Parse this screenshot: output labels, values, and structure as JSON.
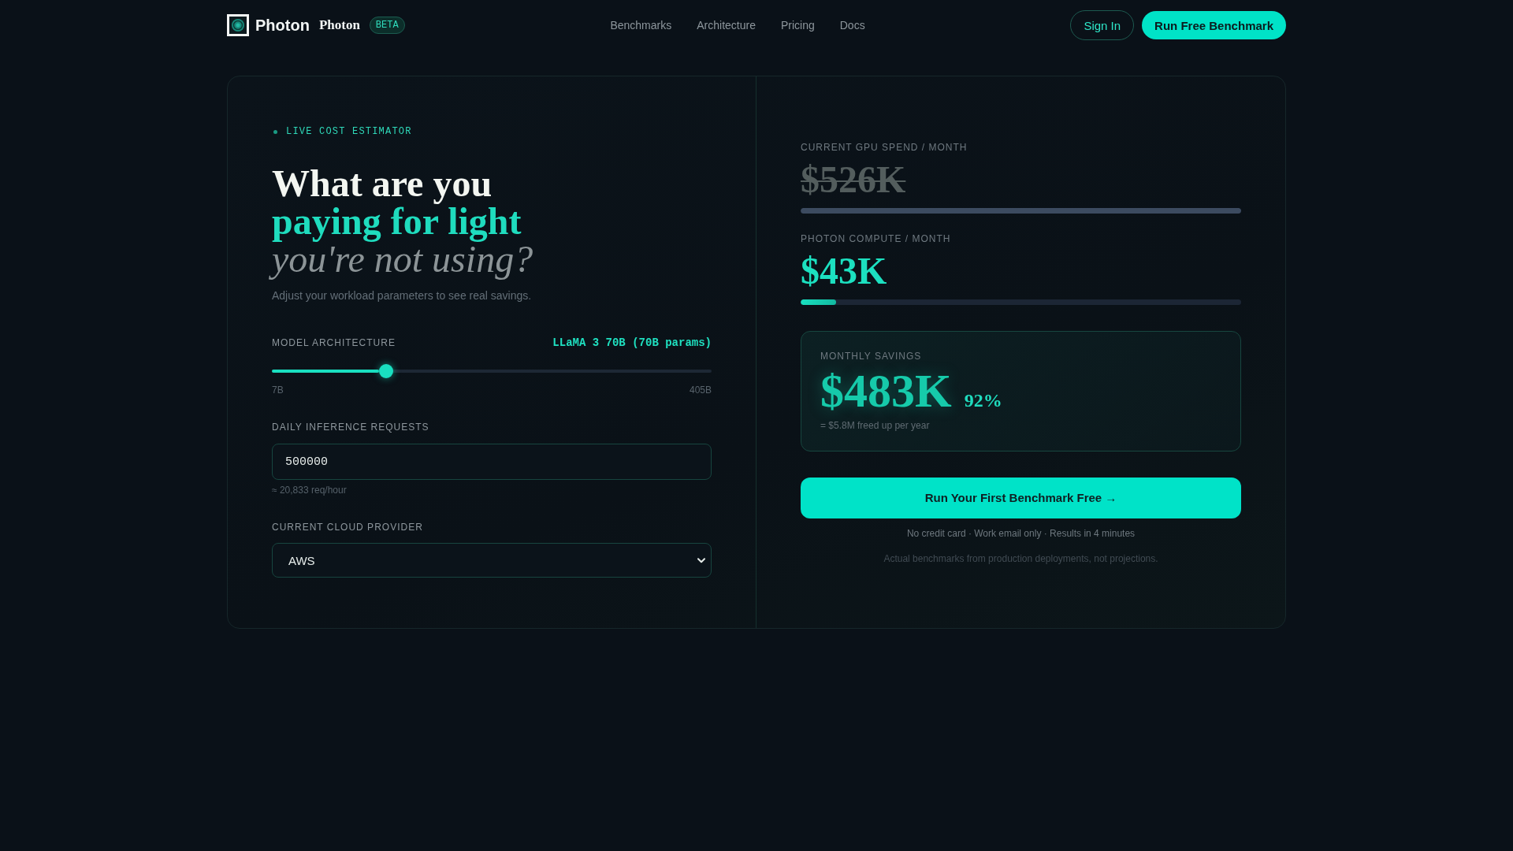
{
  "header": {
    "brand": {
      "wordmark": "Photon",
      "name": "Photon",
      "badge": "BETA"
    },
    "nav": [
      "Benchmarks",
      "Architecture",
      "Pricing",
      "Docs"
    ],
    "actions": [
      {
        "label": "Sign In",
        "kind": "outline"
      },
      {
        "label": "Run Free Benchmark",
        "kind": "primary"
      }
    ]
  },
  "estimator": {
    "eyebrow": "LIVE COST ESTIMATOR",
    "headline": [
      {
        "text": "What are you",
        "kind": "plain"
      },
      {
        "text": "paying for light",
        "kind": "accent"
      },
      {
        "text": "you're not using?",
        "kind": "muted"
      }
    ],
    "subtitle": "Adjust your workload parameters to see real savings.",
    "controls": [
      {
        "kind": "slider",
        "label": "MODEL ARCHITECTURE",
        "value": "LLaMA 3 70B (70B params)",
        "level": 0.26,
        "min_label": "7B",
        "max_label": "405B"
      },
      {
        "kind": "input",
        "label": "DAILY INFERENCE REQUESTS",
        "value": "500000",
        "hint": "≈ 20,833 req/hour"
      },
      {
        "kind": "select",
        "label": "CURRENT CLOUD PROVIDER",
        "value": "AWS"
      }
    ]
  },
  "results": {
    "costs": [
      {
        "kind": "current",
        "label": "CURRENT GPU SPEND / MONTH",
        "amount": "$526K",
        "struck": true,
        "level": 1
      },
      {
        "kind": "photon",
        "label": "PHOTON COMPUTE / MONTH",
        "amount": "$43K",
        "struck": false,
        "level": 0.08
      }
    ],
    "savings": {
      "label": "MONTHLY SAVINGS",
      "amount": "$483K",
      "percent": "92%",
      "note": "= $5.8M freed up per year"
    },
    "cta": "Run Your First Benchmark Free →",
    "note": "No credit card · Work email only · Results in 4 minutes",
    "disclaimer": "Actual benchmarks from production deployments, not projections."
  }
}
